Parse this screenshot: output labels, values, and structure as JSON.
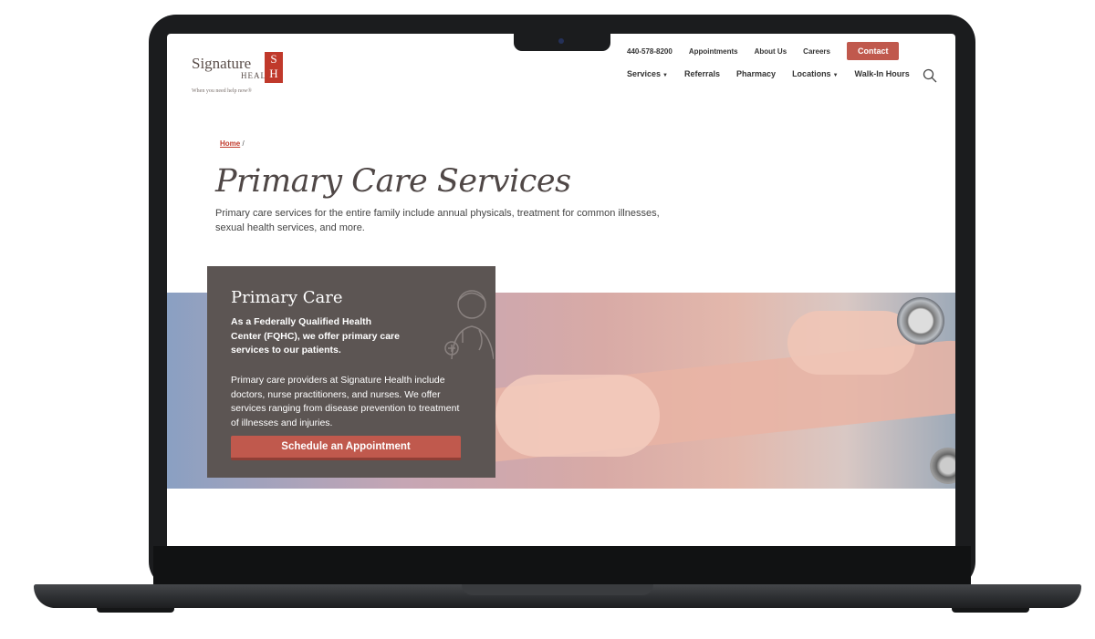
{
  "brand": {
    "name_line1": "Signature",
    "name_line2": "HEALTH",
    "monogram": "S H",
    "tagline": "When you need help now®",
    "accent_color": "#c0594d"
  },
  "topnav": {
    "phone": "440-578-8200",
    "appointments": "Appointments",
    "about": "About Us",
    "careers": "Careers",
    "contact": "Contact"
  },
  "mainnav": {
    "services": "Services",
    "referrals": "Referrals",
    "pharmacy": "Pharmacy",
    "locations": "Locations",
    "walkin": "Walk-In Hours"
  },
  "breadcrumb": {
    "home": "Home",
    "separator": "/"
  },
  "page": {
    "title": "Primary Care Services",
    "subtitle": "Primary care services for the entire family include annual physicals, treatment for common illnesses, sexual health services, and more."
  },
  "card": {
    "title": "Primary Care",
    "lead": "As a Federally Qualified Health Center (FQHC), we offer primary care services to our patients.",
    "body": "Primary care providers at Signature Health include doctors, nurse practitioners, and nurses. We offer services ranging from disease prevention to treatment of illnesses and injuries.",
    "button": "Schedule an Appointment",
    "icon": "doctor-icon"
  }
}
